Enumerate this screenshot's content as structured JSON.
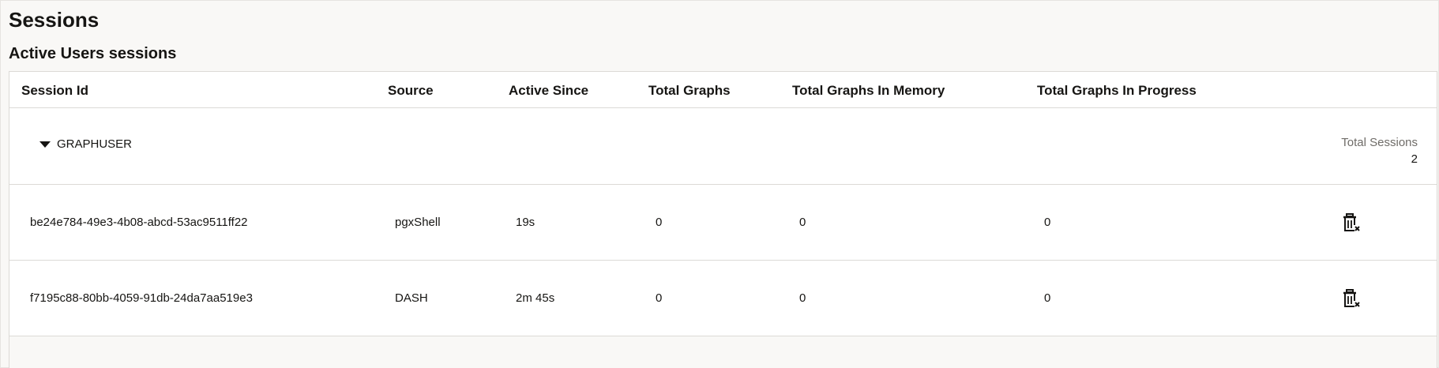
{
  "page": {
    "title": "Sessions",
    "section_title": "Active Users sessions"
  },
  "table": {
    "columns": [
      "Session Id",
      "Source",
      "Active Since",
      "Total Graphs",
      "Total Graphs In Memory",
      "Total Graphs In Progress"
    ],
    "group": {
      "name": "GRAPHUSER",
      "expanded": true,
      "total_label": "Total Sessions",
      "total_value": "2"
    },
    "rows": [
      {
        "session_id": "be24e784-49e3-4b08-abcd-53ac9511ff22",
        "source": "pgxShell",
        "active_since": "19s",
        "total_graphs": "0",
        "total_graphs_in_memory": "0",
        "total_graphs_in_progress": "0",
        "action_icon": "delete-session-icon"
      },
      {
        "session_id": "f7195c88-80bb-4059-91db-24da7aa519e3",
        "source": "DASH",
        "active_since": "2m 45s",
        "total_graphs": "0",
        "total_graphs_in_memory": "0",
        "total_graphs_in_progress": "0",
        "action_icon": "delete-session-icon"
      }
    ]
  },
  "colors": {
    "background": "#f9f8f6",
    "surface": "#ffffff",
    "border": "#dcdad6",
    "text": "#161513",
    "muted_text": "#6f6c68"
  }
}
